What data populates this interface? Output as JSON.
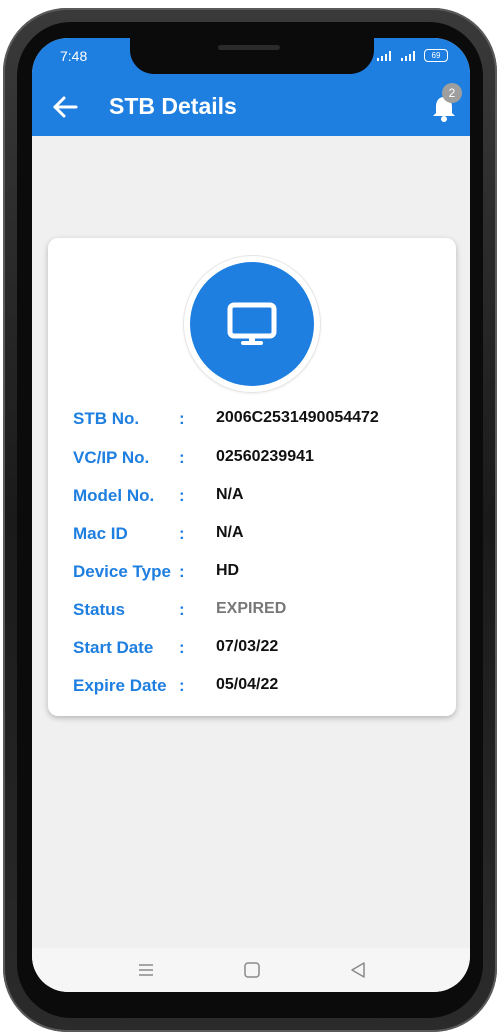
{
  "status_bar": {
    "time": "7:48",
    "battery": "69"
  },
  "header": {
    "title": "STB Details",
    "notification_count": "2"
  },
  "details": [
    {
      "label": "STB No.",
      "colon": ":",
      "value": "2006C2531490054472"
    },
    {
      "label": "VC/IP No.",
      "colon": ":",
      "value": "02560239941"
    },
    {
      "label": "Model No.",
      "colon": ":",
      "value": "N/A"
    },
    {
      "label": "Mac ID",
      "colon": ":",
      "value": "N/A"
    },
    {
      "label": "Device Type",
      "colon": ":",
      "value": "HD"
    },
    {
      "label": "Status",
      "colon": ":",
      "value": "EXPIRED"
    },
    {
      "label": "Start Date",
      "colon": ":",
      "value": "07/03/22"
    },
    {
      "label": "Expire Date",
      "colon": ":",
      "value": "05/04/22"
    }
  ],
  "icons": {
    "back": "arrow-left-icon",
    "notifications": "bell-icon",
    "device": "monitor-icon",
    "nav_menu": "menu-icon",
    "nav_home": "square-icon",
    "nav_back": "triangle-back-icon"
  },
  "colors": {
    "primary": "#1e7fe0",
    "status_expired": "#777777",
    "badge": "#9e9e9e"
  }
}
